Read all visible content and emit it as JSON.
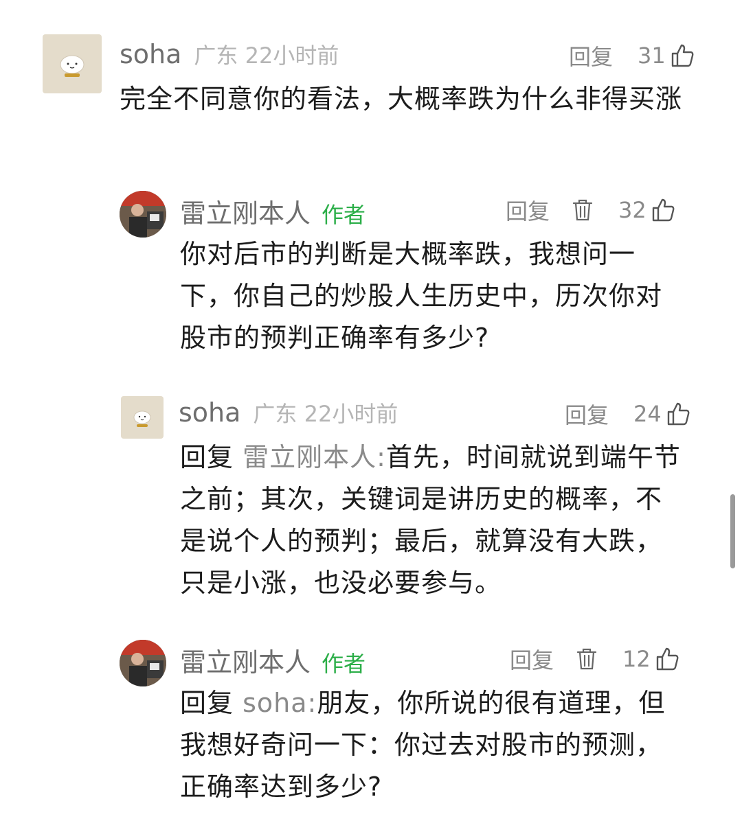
{
  "comments": [
    {
      "name": "soha",
      "location": "广东 22小时前",
      "reply_label": "回复",
      "likes": "31",
      "text": "完全不同意你的看法，大概率跌为什么非得买涨"
    },
    {
      "name": "雷立刚本人",
      "author_tag": "作者",
      "reply_label": "回复",
      "likes": "32",
      "text": "你对后市的判断是大概率跌，我想问一下，你自己的炒股人生历史中，历次你对股市的预判正确率有多少?"
    },
    {
      "name": "soha",
      "location": "广东 22小时前",
      "reply_label": "回复",
      "likes": "24",
      "reply_prefix": "回复",
      "reply_to": "雷立刚本人:",
      "text": "首先，时间就说到端午节之前；其次，关键词是讲历史的概率，不是说个人的预判；最后，就算没有大跌，只是小涨，也没必要参与。"
    },
    {
      "name": "雷立刚本人",
      "author_tag": "作者",
      "reply_label": "回复",
      "likes": "12",
      "reply_prefix": "回复",
      "reply_to": "soha:",
      "text": "朋友，你所说的很有道理，但我想好奇问一下：你过去对股市的预测，正确率达到多少?"
    }
  ],
  "colors": {
    "author_tag": "#2bae48",
    "name": "#6e6e6e",
    "meta": "#b5b5b5"
  },
  "icons": [
    "thumbs-up-icon",
    "trash-icon",
    "avatar-cartoon",
    "avatar-photo"
  ]
}
